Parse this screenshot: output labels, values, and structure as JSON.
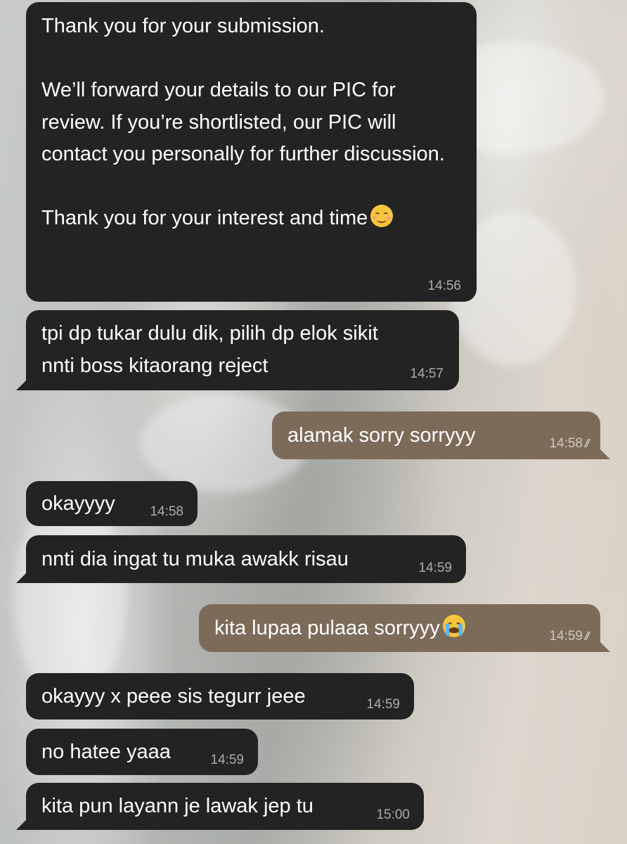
{
  "messages": [
    {
      "direction": "in",
      "text": "Thank you for your submission.\n\nWe’ll forward your details to our PIC for review. If you’re shortlisted, our PIC will contact you personally for further discussion.\n\nThank you for your interest and time",
      "emoji": "smiling-face-icon",
      "time": "14:56"
    },
    {
      "direction": "in",
      "text": "tpi dp tukar dulu dik, pilih dp elok sikit\nnnti boss kitaorang reject",
      "time": "14:57"
    },
    {
      "direction": "out",
      "text": "alamak sorry sorryyy",
      "time": "14:58",
      "status": "read-ticks-icon"
    },
    {
      "direction": "in",
      "text": "okayyyy",
      "time": "14:58"
    },
    {
      "direction": "in",
      "text": "nnti dia ingat tu muka awakk risau",
      "time": "14:59"
    },
    {
      "direction": "out",
      "text": "kita lupaa pulaaa sorryyy",
      "emoji": "crying-face-icon",
      "time": "14:59",
      "status": "read-ticks-icon"
    },
    {
      "direction": "in",
      "text": "okayyy x peee sis tegurr jeee",
      "time": "14:59"
    },
    {
      "direction": "in",
      "text": "no hatee yaaa",
      "time": "14:59"
    },
    {
      "direction": "in",
      "text": "kita pun layann je lawak jep tu",
      "time": "15:00"
    }
  ],
  "colors": {
    "incoming_bubble": "#232323",
    "outgoing_bubble": "#7d6b59",
    "text": "#ffffff"
  }
}
